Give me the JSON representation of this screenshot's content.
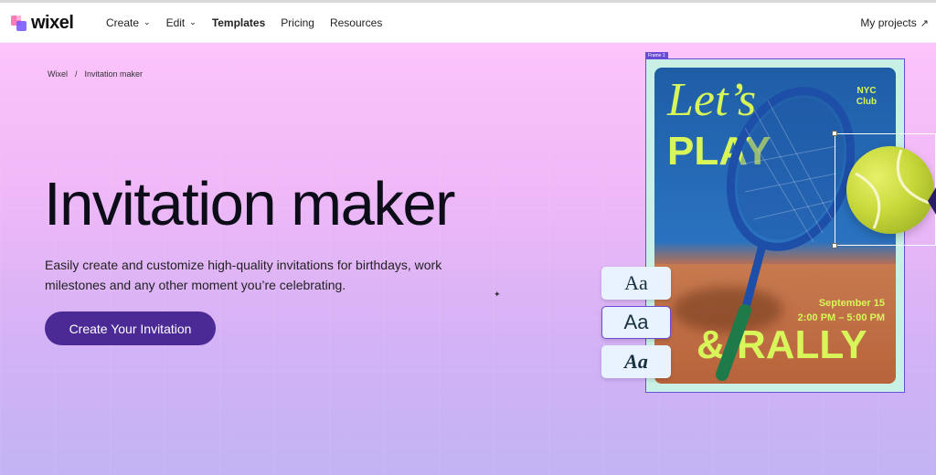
{
  "brand": {
    "name": "wixel"
  },
  "nav": {
    "items": [
      {
        "label": "Create",
        "has_chevron": true
      },
      {
        "label": "Edit",
        "has_chevron": true
      },
      {
        "label": "Templates",
        "has_chevron": false
      },
      {
        "label": "Pricing",
        "has_chevron": false
      },
      {
        "label": "Resources",
        "has_chevron": false
      }
    ],
    "right": {
      "label": "My projects",
      "icon": "external-arrow-icon"
    }
  },
  "breadcrumb": {
    "home": "Wixel",
    "separator": "/",
    "current": "Invitation maker"
  },
  "hero": {
    "title": "Invitation maker",
    "description": "Easily create and customize high-quality invitations for birthdays, work milestones and any other moment you’re celebrating.",
    "cta_label": "Create Your Invitation"
  },
  "preview": {
    "frame_label": "Frame 1",
    "lets": "Let’s",
    "play": "PLAY",
    "club": "NYC Club",
    "date": "September 15",
    "time": "2:00 PM – 5:00 PM",
    "rally": "& RALLY"
  },
  "font_chips": [
    "Aa",
    "Aa",
    "Aa"
  ],
  "colors": {
    "cta": "#4b2a96",
    "accent": "#6a4bd6",
    "poster_text": "#d8f55a"
  }
}
